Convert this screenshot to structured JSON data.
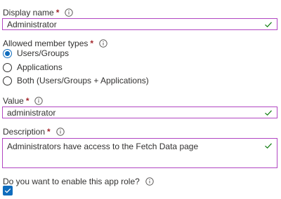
{
  "display_name": {
    "label": "Display name",
    "required_mark": "*",
    "value": "Administrator"
  },
  "member_types": {
    "label": "Allowed member types",
    "required_mark": "*",
    "options": [
      {
        "label": "Users/Groups",
        "selected": true
      },
      {
        "label": "Applications",
        "selected": false
      },
      {
        "label": "Both (Users/Groups + Applications)",
        "selected": false
      }
    ]
  },
  "value_field": {
    "label": "Value",
    "required_mark": "*",
    "value": "administrator"
  },
  "description": {
    "label": "Description",
    "required_mark": "*",
    "value": "Administrators have access to the Fetch Data page"
  },
  "enable_role": {
    "label": "Do you want to enable this app role?",
    "checked": true
  },
  "colors": {
    "accent": "#0f6cbd",
    "valid_border": "#b146c2",
    "valid_check": "#107c10",
    "required": "#a4262c"
  },
  "icons": {
    "info": "info-icon",
    "valid": "checkmark-icon"
  }
}
